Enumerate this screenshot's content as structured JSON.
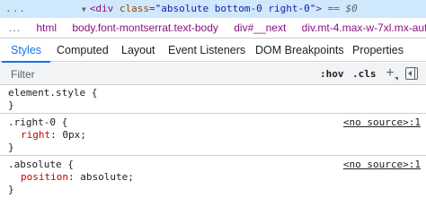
{
  "dom_line": {
    "dots": "...",
    "open": "<div",
    "attr_name": " class",
    "eq": "=",
    "attr_value": "\"absolute bottom-0 right-0\"",
    "close": ">",
    "ref": " == $0"
  },
  "breadcrumbs": {
    "dots": "...",
    "items": [
      "html",
      "body.font-montserrat.text-body",
      "div#__next",
      "div.mt-4.max-w-7xl.mx-aut"
    ]
  },
  "tabs": {
    "items": [
      "Styles",
      "Computed",
      "Layout",
      "Event Listeners",
      "DOM Breakpoints",
      "Properties"
    ],
    "active": "Styles"
  },
  "filter": {
    "placeholder": "Filter",
    "hov_label": ":hov",
    "cls_label": ".cls"
  },
  "rules": [
    {
      "selector": "element.style",
      "open": " {",
      "close": "}",
      "props": [],
      "source": ""
    },
    {
      "selector": ".right-0",
      "open": " {",
      "close": "}",
      "props": [
        {
          "name": "right",
          "value": "0px;"
        }
      ],
      "source": "<no source>:1"
    },
    {
      "selector": ".absolute",
      "open": " {",
      "close": "}",
      "props": [
        {
          "name": "position",
          "value": "absolute;"
        }
      ],
      "source": "<no source>:1"
    }
  ]
}
